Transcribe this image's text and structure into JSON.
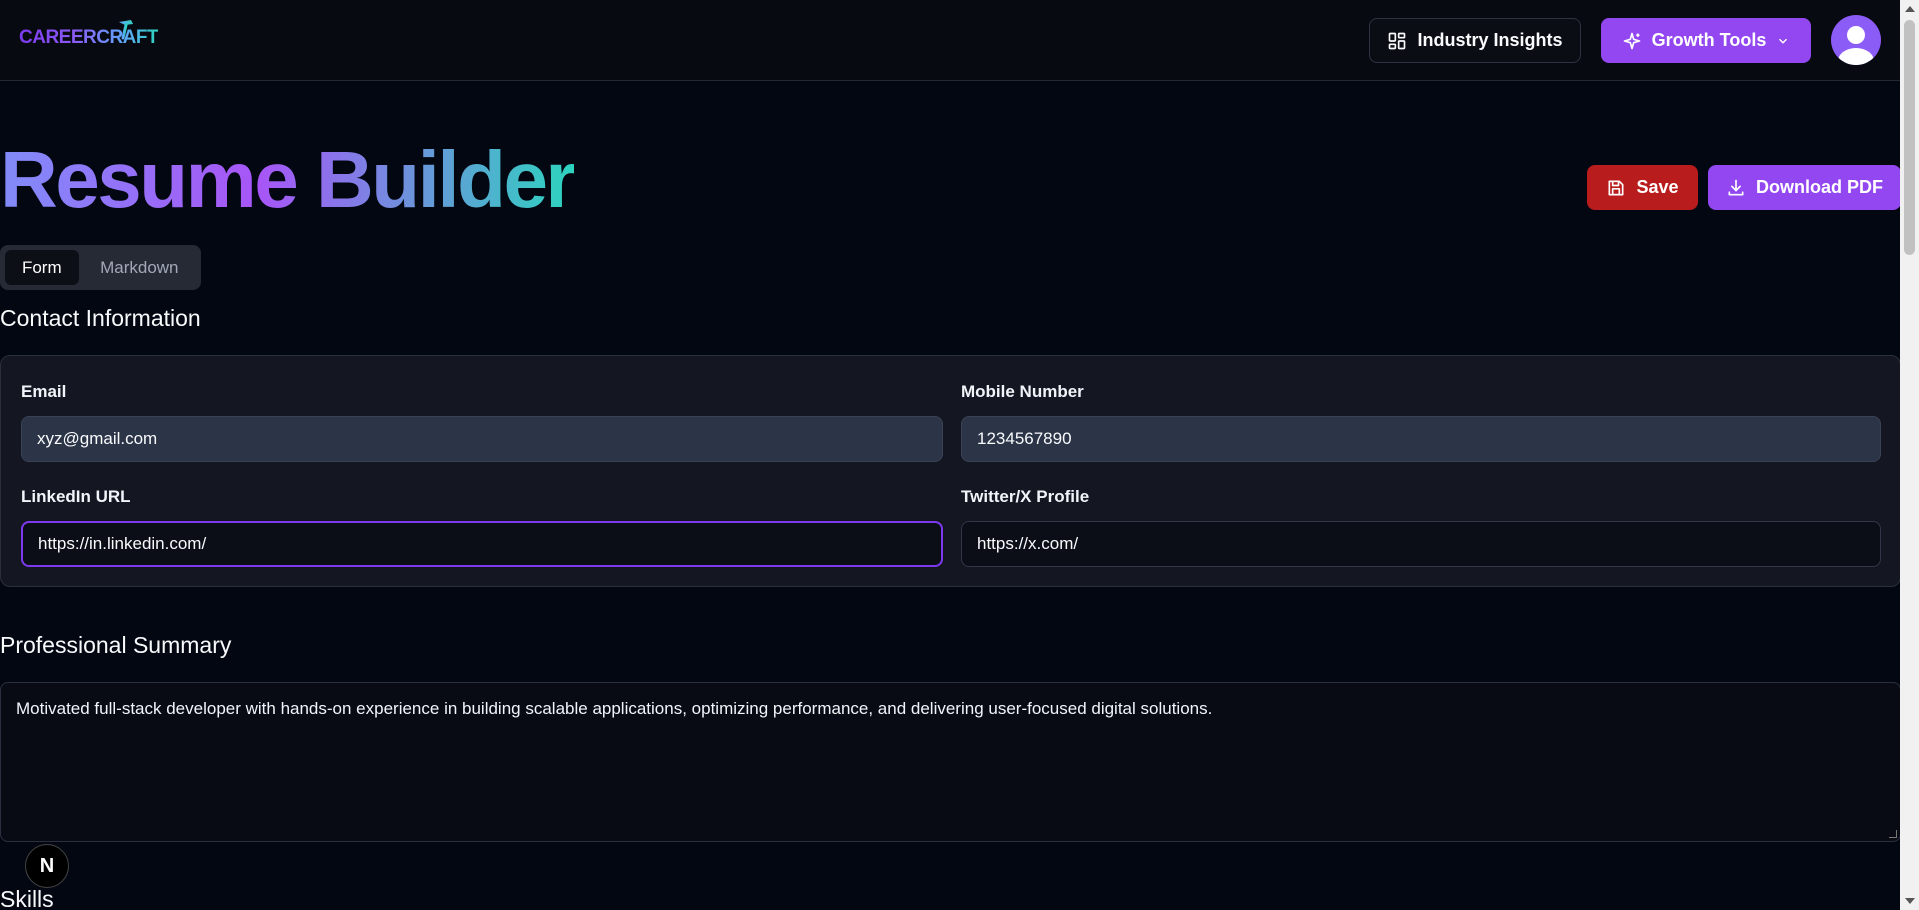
{
  "header": {
    "logo_text": "CAREERCRAFT",
    "industry_insights_label": "Industry Insights",
    "growth_tools_label": "Growth Tools"
  },
  "page": {
    "title": "Resume Builder",
    "save_label": "Save",
    "download_label": "Download PDF"
  },
  "tabs": [
    {
      "label": "Form",
      "active": true
    },
    {
      "label": "Markdown",
      "active": false
    }
  ],
  "contact": {
    "section_title": "Contact Information",
    "email_label": "Email",
    "email_value": "xyz@gmail.com",
    "mobile_label": "Mobile Number",
    "mobile_value": "1234567890",
    "linkedin_label": "LinkedIn URL",
    "linkedin_value": "https://in.linkedin.com/",
    "twitter_label": "Twitter/X Profile",
    "twitter_value": "https://x.com/"
  },
  "summary": {
    "section_title": "Professional Summary",
    "text": "Motivated full-stack developer with hands-on experience in building scalable applications, optimizing performance, and delivering user-focused digital solutions."
  },
  "skills": {
    "section_title": "Skills"
  },
  "badge": {
    "label": "N"
  },
  "colors": {
    "accent": "#9347f0",
    "danger": "#b91c1c",
    "background": "#030712"
  }
}
